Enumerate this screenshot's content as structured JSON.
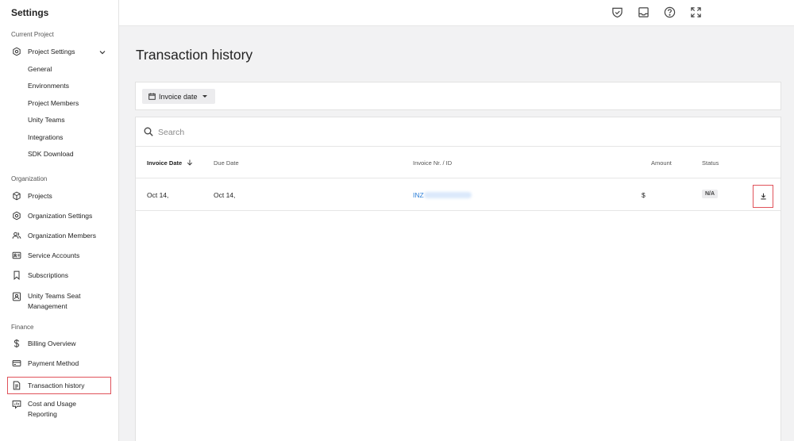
{
  "sidebar": {
    "title": "Settings",
    "current_project_label": "Current Project",
    "project_settings": "Project Settings",
    "project_sub": [
      "General",
      "Environments",
      "Project Members",
      "Unity Teams",
      "Integrations",
      "SDK Download"
    ],
    "organization_label": "Organization",
    "org_items": [
      "Projects",
      "Organization Settings",
      "Organization Members",
      "Service Accounts",
      "Subscriptions",
      "Unity Teams Seat Management"
    ],
    "finance_label": "Finance",
    "finance_items": [
      "Billing Overview",
      "Payment Method",
      "Transaction history",
      "Cost and Usage Reporting"
    ]
  },
  "main": {
    "title": "Transaction history",
    "filter_label": "Invoice date",
    "search_placeholder": "Search",
    "columns": {
      "invoice_date": "Invoice Date",
      "due_date": "Due Date",
      "invoice_nr": "Invoice Nr. / ID",
      "amount": "Amount",
      "status": "Status"
    },
    "rows": [
      {
        "invoice_date": "Oct 14,",
        "due_date": "Oct 14,",
        "invoice_nr": "INZ",
        "amount": "$",
        "status": "N/A"
      }
    ]
  }
}
